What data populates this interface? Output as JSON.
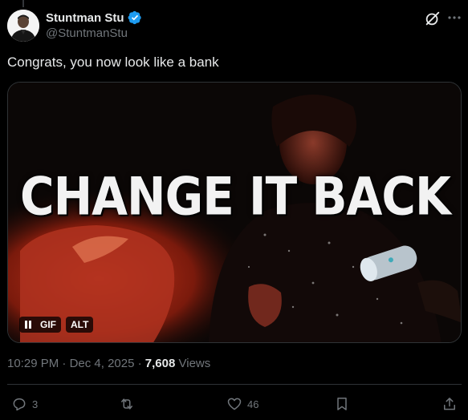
{
  "tweet": {
    "author": {
      "display_name": "Stuntman Stu",
      "handle": "@StuntmanStu",
      "verified": true,
      "verified_color": "#1d9bf0"
    },
    "text": "Congrats, you now look like a bank",
    "media": {
      "caption": "CHANGE IT BACK",
      "controls": {
        "gif_label": "GIF",
        "alt_label": "ALT"
      }
    },
    "meta": {
      "time": "10:29 PM",
      "separator": "·",
      "date": "Dec 4, 2025",
      "views_count": "7,608",
      "views_label": "Views"
    },
    "actions": {
      "replies": "3",
      "reposts": "",
      "likes": "46"
    }
  },
  "colors": {
    "background": "#000000",
    "text_primary": "#e7e9ea",
    "text_secondary": "#71767b",
    "border": "#2f3336"
  },
  "icons": {
    "header": [
      "grok-icon",
      "more-icon"
    ],
    "actions": [
      "reply-icon",
      "repost-icon",
      "like-icon",
      "bookmark-icon",
      "share-icon"
    ]
  }
}
